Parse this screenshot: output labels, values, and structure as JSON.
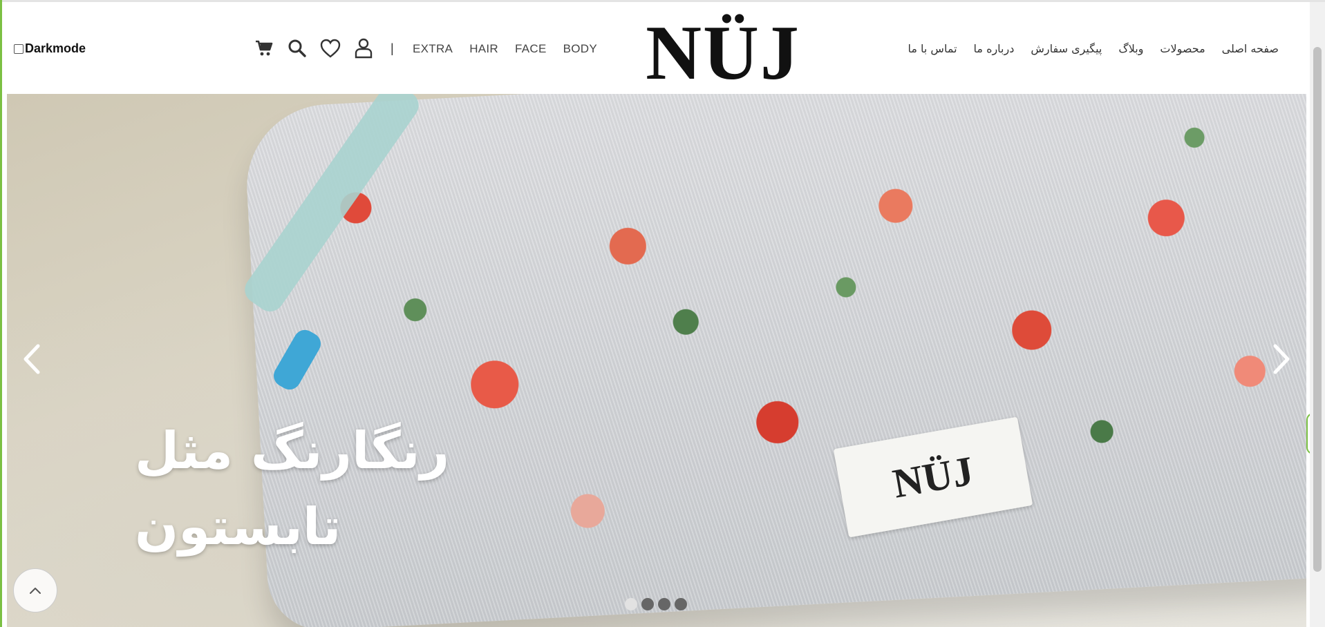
{
  "header": {
    "darkmode_label": "Darkmode",
    "separator": "|",
    "icons": [
      "cart-icon",
      "search-icon",
      "heart-icon",
      "user-icon"
    ],
    "category_nav": [
      "EXTRA",
      "HAIR",
      "FACE",
      "BODY"
    ],
    "logo_text": "NÜJ",
    "main_nav": [
      "صفحه اصلی",
      "محصولات",
      "وبلاگ",
      "پیگیری سفارش",
      "درباره ما",
      "تماس با ما"
    ]
  },
  "hero": {
    "caption": "رنگارنگ مثل تابستون",
    "product_label": "NÜJ",
    "slides_count": 4,
    "active_slide": 1
  },
  "colors": {
    "accent_green": "#7bc043",
    "text_dark": "#111111"
  }
}
